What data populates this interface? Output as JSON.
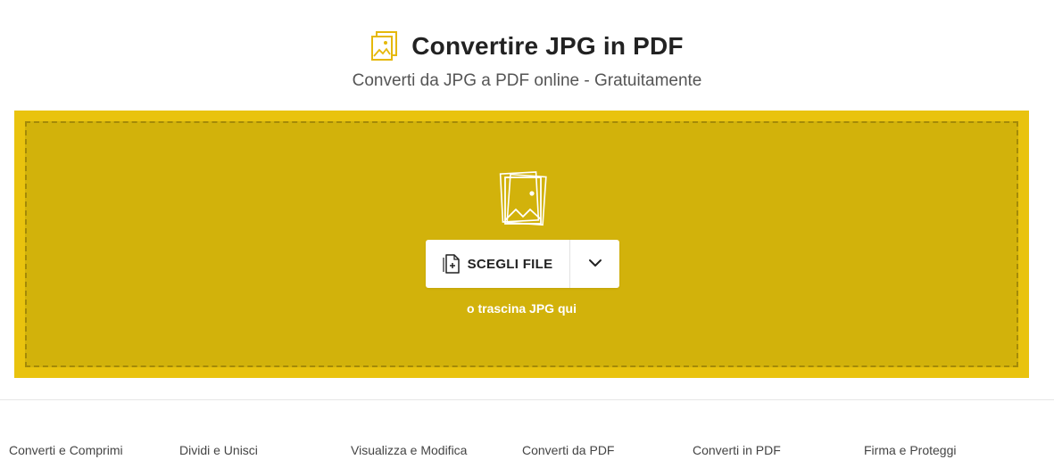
{
  "header": {
    "title": "Convertire JPG in PDF",
    "subtitle": "Converti da JPG a PDF online - Gratuitamente",
    "icon": "jpg-image-icon"
  },
  "dropzone": {
    "illustration": "image-stack-icon",
    "choose_button_label": "SCEGLI FILE",
    "choose_button_icon": "file-add-icon",
    "dropdown_icon": "chevron-down-icon",
    "hint": "o trascina JPG qui"
  },
  "footer": {
    "links": [
      "Converti e Comprimi",
      "Dividi e Unisci",
      "Visualizza e Modifica",
      "Converti da PDF",
      "Converti in PDF",
      "Firma e Proteggi"
    ]
  },
  "colors": {
    "accent_outer": "#e9c30e",
    "accent_inner": "#d2b20b",
    "dashed_border": "#a48a08",
    "icon_yellow": "#e5b80b"
  }
}
